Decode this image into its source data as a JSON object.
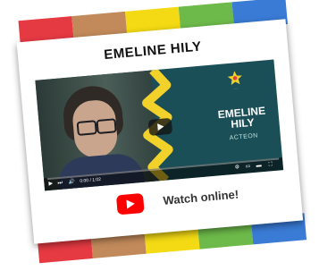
{
  "card": {
    "title": "EMELINE HILY",
    "stripe_colors": [
      "#e63a43",
      "#c28a5a",
      "#f3da14",
      "#6dba4a",
      "#3a7bd5"
    ]
  },
  "video": {
    "overlay_name": "EMELINE\nHILY",
    "overlay_subtitle": "ACTEON",
    "timecode": "0:00 / 1:02",
    "progress": 0.0,
    "colors": {
      "background": "#1b4f57",
      "accent_yellow": "#f1d12a"
    }
  },
  "watch_link": {
    "label": "Watch online!",
    "icon": "youtube-play-icon"
  }
}
